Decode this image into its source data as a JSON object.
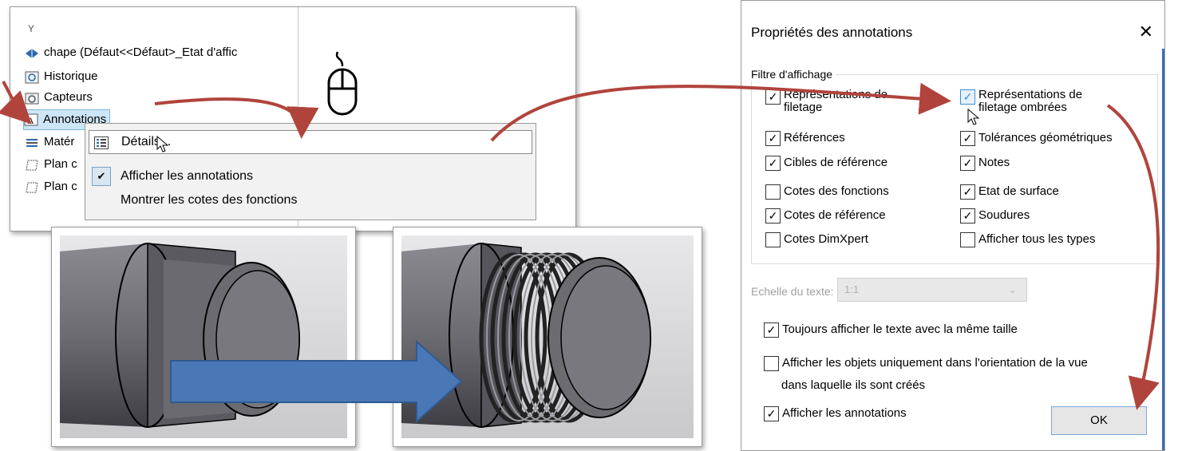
{
  "tree": {
    "filter_glyph": "Y",
    "items": [
      {
        "label": "chape  (Défaut<<Défaut>_Etat d'affic",
        "icon": "part-icon"
      },
      {
        "label": "Historique",
        "icon": "history-icon"
      },
      {
        "label": "Capteurs",
        "icon": "sensors-icon"
      },
      {
        "label": "Annotations",
        "icon": "annotations-icon"
      },
      {
        "label": "Matér",
        "icon": "material-icon"
      },
      {
        "label": "Plan c",
        "icon": "plane-icon"
      },
      {
        "label": "Plan c",
        "icon": "plane-icon"
      }
    ]
  },
  "context_menu": {
    "details": "Détails...",
    "show_annotations": "Afficher les annotations",
    "show_feature_dims": "Montrer les cotes des fonctions"
  },
  "dialog": {
    "title": "Propriétés des annotations",
    "close": "✕",
    "filter_group": "Filtre d'affichage",
    "left_options": [
      {
        "label": "Représentations de\nfiletage",
        "checked": true
      },
      {
        "label": "Références",
        "checked": true
      },
      {
        "label": "Cibles de référence",
        "checked": true
      },
      {
        "label": "Cotes des fonctions",
        "checked": false
      },
      {
        "label": "Cotes de référence",
        "checked": true
      },
      {
        "label": "Cotes DimXpert",
        "checked": false
      }
    ],
    "right_options": [
      {
        "label": "Représentations de\nfiletage ombrées",
        "checked": true
      },
      {
        "label": "Tolérances géométriques",
        "checked": true
      },
      {
        "label": "Notes",
        "checked": true
      },
      {
        "label": "Etat de surface",
        "checked": true
      },
      {
        "label": "Soudures",
        "checked": true
      },
      {
        "label": "Afficher tous les types",
        "checked": false
      }
    ],
    "text_scale_label": "Echelle du texte:",
    "text_scale_value": "1:1",
    "always_same_size": {
      "label": "Toujours afficher le texte avec la même taille",
      "checked": true
    },
    "only_orientation": {
      "label": "Afficher les objets uniquement dans l'orientation de la vue",
      "label2": "dans laquelle ils sont créés",
      "checked": false
    },
    "show_annotations": {
      "label": "Afficher les annotations",
      "checked": true
    },
    "ok": "OK"
  },
  "colors": {
    "arrow_red": "#b0443c",
    "big_arrow_blue": "#4a78b6",
    "selection_blue": "#cde6f7"
  }
}
